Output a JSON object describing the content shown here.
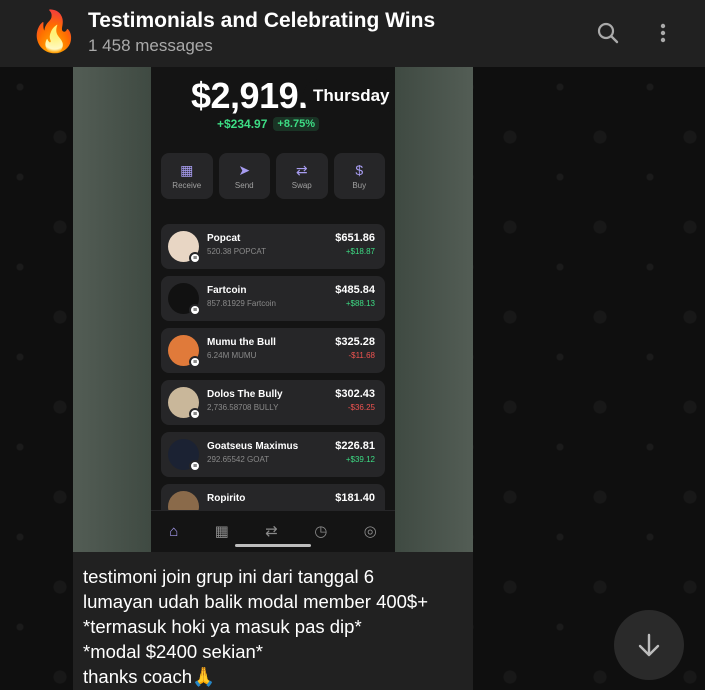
{
  "header": {
    "avatar_icon": "fire-emoji",
    "avatar_glyph": "🔥",
    "title": "Testimonials and Celebrating Wins",
    "subtitle": "1 458 messages",
    "search_icon": "search-icon",
    "menu_icon": "more-vertical-icon"
  },
  "message": {
    "media": {
      "balance": "$2,919.",
      "day_badge": "Thursday",
      "change_amount": "+$234.97",
      "change_percent": "+8.75%",
      "actions": [
        {
          "label": "Receive",
          "icon": "qr-code-icon",
          "glyph": "▦"
        },
        {
          "label": "Send",
          "icon": "send-icon",
          "glyph": "➤"
        },
        {
          "label": "Swap",
          "icon": "swap-icon",
          "glyph": "⇄"
        },
        {
          "label": "Buy",
          "icon": "dollar-icon",
          "glyph": "$"
        }
      ],
      "tokens": [
        {
          "name": "Popcat",
          "amount": "520.38 POPCAT",
          "value": "$651.86",
          "delta": "+$18.87",
          "positive": true,
          "color": "#e8d6c4"
        },
        {
          "name": "Fartcoin",
          "amount": "857.81929 Fartcoin",
          "value": "$485.84",
          "delta": "+$88.13",
          "positive": true,
          "color": "#111111"
        },
        {
          "name": "Mumu the Bull",
          "amount": "6.24M MUMU",
          "value": "$325.28",
          "delta": "-$11.68",
          "positive": false,
          "color": "#e07a3a"
        },
        {
          "name": "Dolos The Bully",
          "amount": "2,736.58708 BULLY",
          "value": "$302.43",
          "delta": "-$36.25",
          "positive": false,
          "color": "#c9b79a"
        },
        {
          "name": "Goatseus Maximus",
          "amount": "292.65542 GOAT",
          "value": "$226.81",
          "delta": "+$39.12",
          "positive": true,
          "color": "#1b2233"
        },
        {
          "name": "Ropirito",
          "amount": "",
          "value": "$181.40",
          "delta": "",
          "positive": true,
          "color": "#8a6a4a"
        }
      ],
      "nav": [
        {
          "icon": "home-icon",
          "glyph": "⌂",
          "active": true
        },
        {
          "icon": "grid-icon",
          "glyph": "▦",
          "active": false
        },
        {
          "icon": "swap-icon",
          "glyph": "⇄",
          "active": false
        },
        {
          "icon": "clock-icon",
          "glyph": "◷",
          "active": false
        },
        {
          "icon": "compass-icon",
          "glyph": "◎",
          "active": false
        }
      ]
    },
    "caption_lines": [
      "testimoni join grup ini dari tanggal 6",
      "lumayan udah balik modal member 400$+",
      "*termasuk hoki ya masuk pas dip*",
      "*modal $2400 sekian*",
      "thanks coach🙏"
    ]
  },
  "scroll_down_icon": "arrow-down-icon",
  "colors": {
    "header_bg": "#212121",
    "bubble_bg": "#212121",
    "accent_purple": "#a79cf0",
    "positive": "#3ddc84",
    "negative": "#ef5350"
  }
}
